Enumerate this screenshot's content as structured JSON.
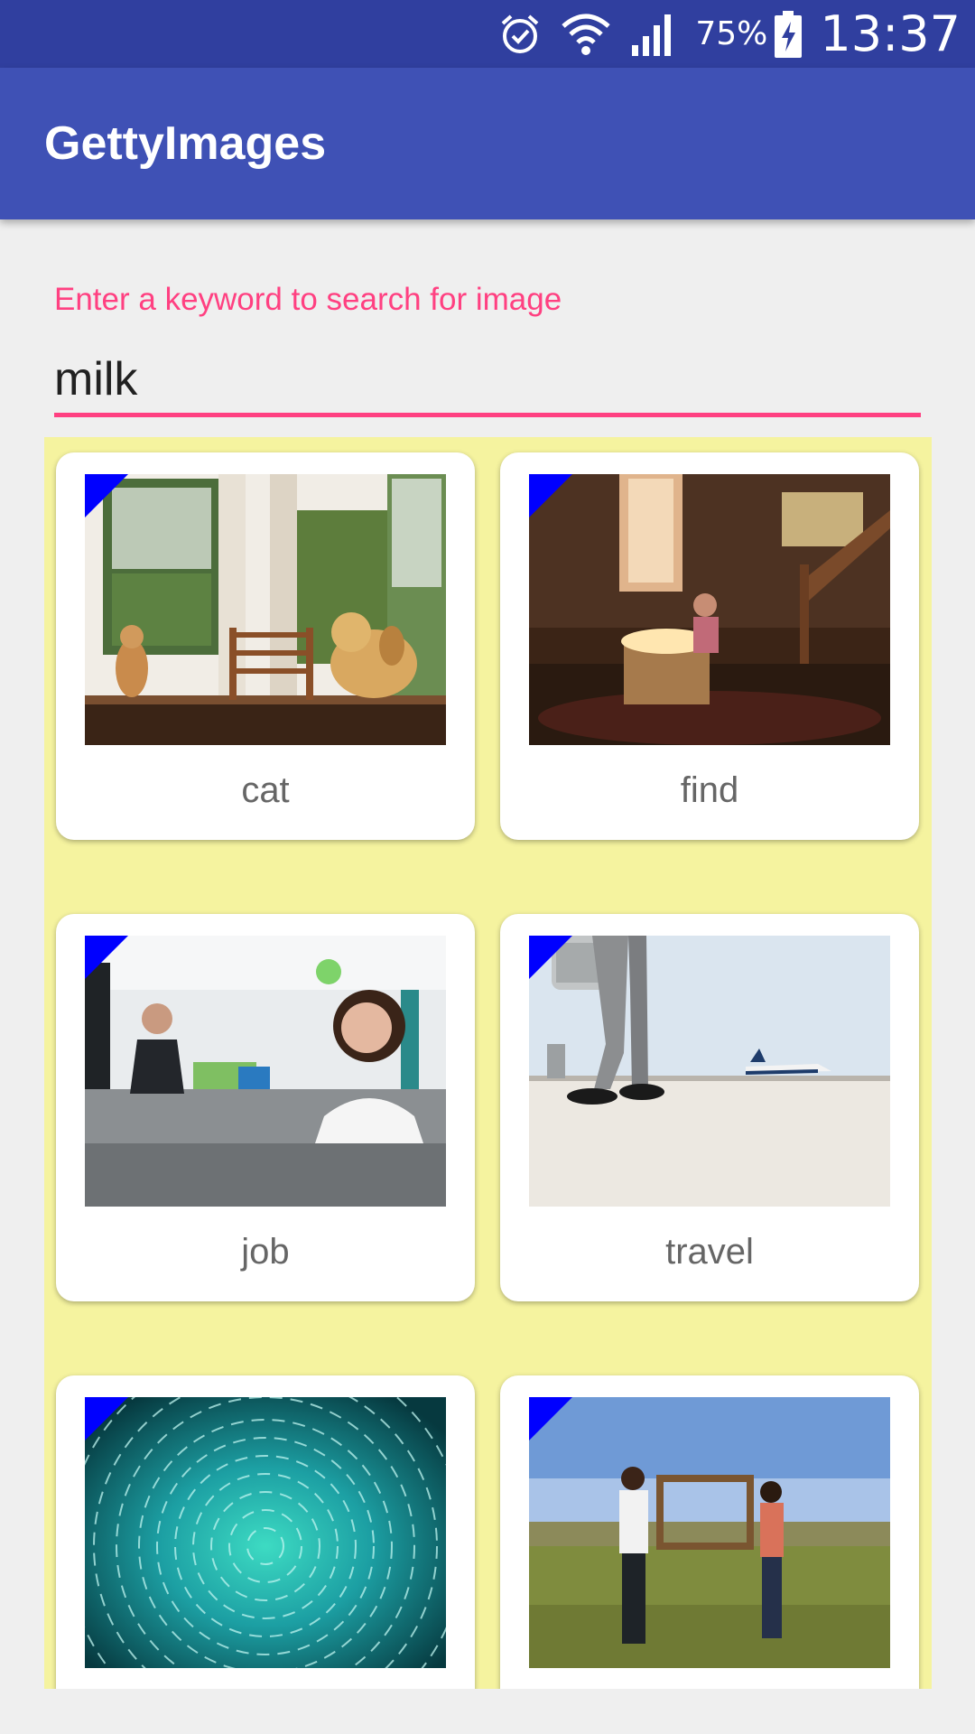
{
  "status_bar": {
    "battery": "75%",
    "time": "13:37",
    "icons": [
      "alarm-icon",
      "wifi-icon",
      "signal-icon",
      "battery-charging-icon"
    ]
  },
  "app_bar": {
    "title": "GettyImages"
  },
  "search": {
    "label": "Enter a keyword to search for image",
    "value": "milk"
  },
  "colors": {
    "primary_dark": "#303f9f",
    "primary": "#3f51b5",
    "accent": "#ff4081",
    "grid_background": "#f5f39f",
    "corner_marker": "#0000ff"
  },
  "results": [
    {
      "caption": "cat"
    },
    {
      "caption": "find"
    },
    {
      "caption": "job"
    },
    {
      "caption": "travel"
    },
    {
      "caption": ""
    },
    {
      "caption": ""
    }
  ]
}
